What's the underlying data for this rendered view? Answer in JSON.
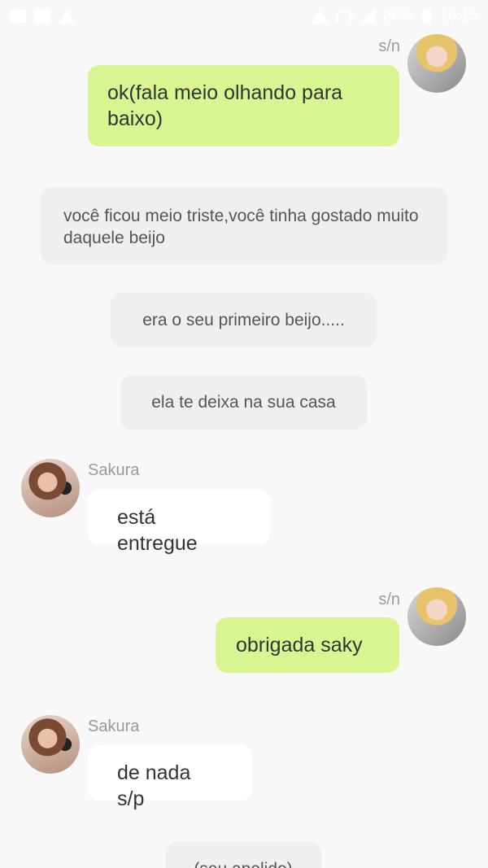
{
  "status_bar": {
    "battery_text": "86%",
    "time": "16:15"
  },
  "messages": [
    {
      "sender": "s/n",
      "text": "ok(fala meio olhando para baixo)"
    },
    {
      "narration": "você ficou meio triste,você tinha gostado muito daquele beijo"
    },
    {
      "narration": "era o seu primeiro beijo....."
    },
    {
      "narration": "ela te deixa na sua casa"
    },
    {
      "sender": "Sakura",
      "text": "está entregue"
    },
    {
      "sender": "s/n",
      "text": "obrigada saky"
    },
    {
      "sender": "Sakura",
      "text": "de nada s/p"
    },
    {
      "narration": "(seu apelido)"
    }
  ]
}
